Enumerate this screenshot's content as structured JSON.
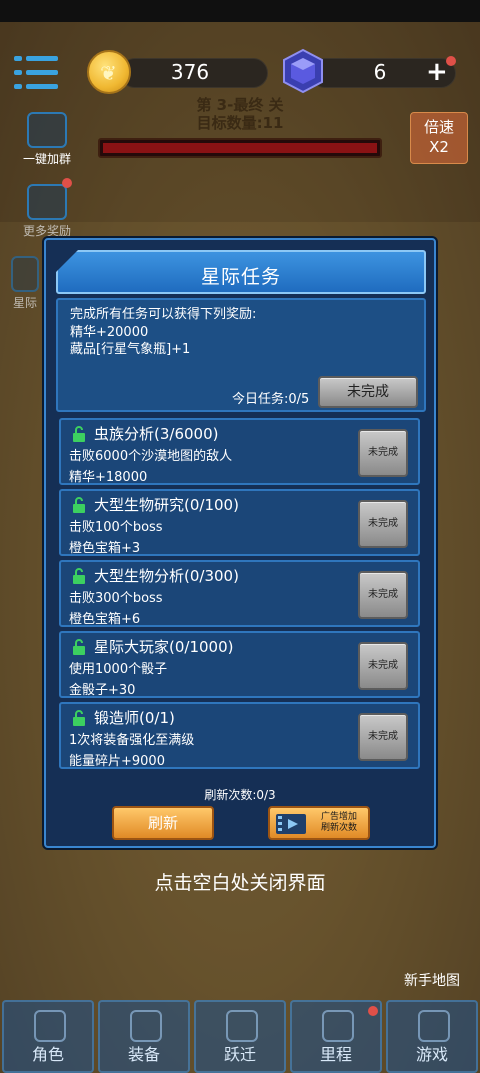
{
  "hud": {
    "coins": "376",
    "gems": "6",
    "plus": "+",
    "level_line1": "第 3-最终 关",
    "level_line2": "目标数量:11",
    "speed_line1": "倍速",
    "speed_line2": "X2",
    "side_add_group": "一键加群",
    "side_more_rewards": "更多奖励",
    "side_star": "星际"
  },
  "panel": {
    "title": "星际任务",
    "summary_intro": "完成所有任务可以获得下列奖励:",
    "reward_1": "精华+20000",
    "reward_2": "藏品[行星气象瓶]+1",
    "today_tasks": "今日任务:0/5",
    "status_button": "未完成",
    "quests": [
      {
        "title": "虫族分析(3/6000)",
        "desc": "击败6000个沙漠地图的敌人",
        "reward": "精华+18000",
        "button": "未完成"
      },
      {
        "title": "大型生物研究(0/100)",
        "desc": "击败100个boss",
        "reward": "橙色宝箱+3",
        "button": "未完成"
      },
      {
        "title": "大型生物分析(0/300)",
        "desc": "击败300个boss",
        "reward": "橙色宝箱+6",
        "button": "未完成"
      },
      {
        "title": "星际大玩家(0/1000)",
        "desc": "使用1000个骰子",
        "reward": "金骰子+30",
        "button": "未完成"
      },
      {
        "title": "锻造师(0/1)",
        "desc": "1次将装备强化至满级",
        "reward": "能量碎片+9000",
        "button": "未完成"
      }
    ],
    "refresh_count": "刷新次数:0/3",
    "refresh_button": "刷新",
    "ad_button_line1": "广告增加",
    "ad_button_line2": "刷新次数"
  },
  "close_hint": "点击空白处关闭界面",
  "map_label": "新手地图",
  "nav": [
    "角色",
    "装备",
    "跃迁",
    "里程",
    "游戏"
  ],
  "colors": {
    "panel_bg": "#152f55",
    "accent_blue": "#3a86d0",
    "orange": "#e08a26",
    "hp_red": "#8a1214"
  }
}
